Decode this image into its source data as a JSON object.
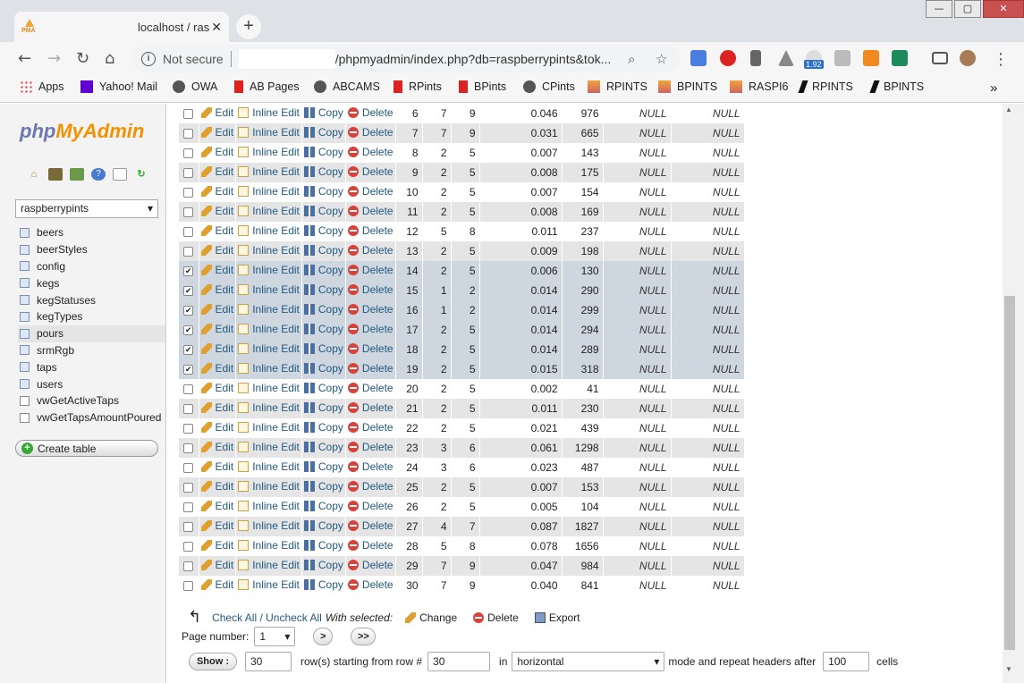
{
  "browser": {
    "tab_title": "localhost / ras",
    "tab_close": "✕",
    "newtab": "+",
    "window_min": "—",
    "window_max": "▢",
    "window_close": "✕",
    "security": "Not secure",
    "url": "/phpmyadmin/index.php?db=raspberrypints&tok...",
    "badge": "1.92",
    "favicon_text": "PMA"
  },
  "bookmarks": [
    {
      "label": "Apps",
      "icon": "apps-grid-icon"
    },
    {
      "label": "Yahoo! Mail",
      "icon": "envelope-icon"
    },
    {
      "label": "OWA",
      "icon": "globe-icon"
    },
    {
      "label": "AB Pages",
      "icon": "cup-icon"
    },
    {
      "label": "ABCAMS",
      "icon": "globe-icon"
    },
    {
      "label": "RPints",
      "icon": "cup-icon"
    },
    {
      "label": "BPints",
      "icon": "cup-icon"
    },
    {
      "label": "CPints",
      "icon": "globe-icon"
    },
    {
      "label": "RPINTS",
      "icon": "pma-icon"
    },
    {
      "label": "BPINTS",
      "icon": "pma-icon"
    },
    {
      "label": "RASPI6",
      "icon": "pma-icon"
    },
    {
      "label": "RPINTS",
      "icon": "feather-icon"
    },
    {
      "label": "BPINTS",
      "icon": "feather-icon"
    }
  ],
  "bookmarks_more": "»",
  "nav": {
    "logo_a": "php",
    "logo_b": "MyAdmin",
    "db_selected": "raspberrypints",
    "tables": [
      "beers",
      "beerStyles",
      "config",
      "kegs",
      "kegStatuses",
      "kegTypes",
      "pours",
      "srmRgb",
      "taps",
      "users",
      "vwGetActiveTaps",
      "vwGetTapsAmountPoured"
    ],
    "selected_table": "pours",
    "create_table": "Create table"
  },
  "actions": {
    "edit": "Edit",
    "inline_edit": "Inline Edit",
    "copy": "Copy",
    "delete": "Delete"
  },
  "rows": [
    {
      "id": "6",
      "a": "7",
      "b": "9",
      "c": "0.046",
      "d": "976",
      "e": "NULL",
      "f": "NULL",
      "checked": false
    },
    {
      "id": "7",
      "a": "7",
      "b": "9",
      "c": "0.031",
      "d": "665",
      "e": "NULL",
      "f": "NULL",
      "checked": false
    },
    {
      "id": "8",
      "a": "2",
      "b": "5",
      "c": "0.007",
      "d": "143",
      "e": "NULL",
      "f": "NULL",
      "checked": false
    },
    {
      "id": "9",
      "a": "2",
      "b": "5",
      "c": "0.008",
      "d": "175",
      "e": "NULL",
      "f": "NULL",
      "checked": false
    },
    {
      "id": "10",
      "a": "2",
      "b": "5",
      "c": "0.007",
      "d": "154",
      "e": "NULL",
      "f": "NULL",
      "checked": false
    },
    {
      "id": "11",
      "a": "2",
      "b": "5",
      "c": "0.008",
      "d": "169",
      "e": "NULL",
      "f": "NULL",
      "checked": false
    },
    {
      "id": "12",
      "a": "5",
      "b": "8",
      "c": "0.011",
      "d": "237",
      "e": "NULL",
      "f": "NULL",
      "checked": false
    },
    {
      "id": "13",
      "a": "2",
      "b": "5",
      "c": "0.009",
      "d": "198",
      "e": "NULL",
      "f": "NULL",
      "checked": false
    },
    {
      "id": "14",
      "a": "2",
      "b": "5",
      "c": "0.006",
      "d": "130",
      "e": "NULL",
      "f": "NULL",
      "checked": true
    },
    {
      "id": "15",
      "a": "1",
      "b": "2",
      "c": "0.014",
      "d": "290",
      "e": "NULL",
      "f": "NULL",
      "checked": true
    },
    {
      "id": "16",
      "a": "1",
      "b": "2",
      "c": "0.014",
      "d": "299",
      "e": "NULL",
      "f": "NULL",
      "checked": true
    },
    {
      "id": "17",
      "a": "2",
      "b": "5",
      "c": "0.014",
      "d": "294",
      "e": "NULL",
      "f": "NULL",
      "checked": true
    },
    {
      "id": "18",
      "a": "2",
      "b": "5",
      "c": "0.014",
      "d": "289",
      "e": "NULL",
      "f": "NULL",
      "checked": true
    },
    {
      "id": "19",
      "a": "2",
      "b": "5",
      "c": "0.015",
      "d": "318",
      "e": "NULL",
      "f": "NULL",
      "checked": true
    },
    {
      "id": "20",
      "a": "2",
      "b": "5",
      "c": "0.002",
      "d": "41",
      "e": "NULL",
      "f": "NULL",
      "checked": false
    },
    {
      "id": "21",
      "a": "2",
      "b": "5",
      "c": "0.011",
      "d": "230",
      "e": "NULL",
      "f": "NULL",
      "checked": false
    },
    {
      "id": "22",
      "a": "2",
      "b": "5",
      "c": "0.021",
      "d": "439",
      "e": "NULL",
      "f": "NULL",
      "checked": false
    },
    {
      "id": "23",
      "a": "3",
      "b": "6",
      "c": "0.061",
      "d": "1298",
      "e": "NULL",
      "f": "NULL",
      "checked": false
    },
    {
      "id": "24",
      "a": "3",
      "b": "6",
      "c": "0.023",
      "d": "487",
      "e": "NULL",
      "f": "NULL",
      "checked": false
    },
    {
      "id": "25",
      "a": "2",
      "b": "5",
      "c": "0.007",
      "d": "153",
      "e": "NULL",
      "f": "NULL",
      "checked": false
    },
    {
      "id": "26",
      "a": "2",
      "b": "5",
      "c": "0.005",
      "d": "104",
      "e": "NULL",
      "f": "NULL",
      "checked": false
    },
    {
      "id": "27",
      "a": "4",
      "b": "7",
      "c": "0.087",
      "d": "1827",
      "e": "NULL",
      "f": "NULL",
      "checked": false
    },
    {
      "id": "28",
      "a": "5",
      "b": "8",
      "c": "0.078",
      "d": "1656",
      "e": "NULL",
      "f": "NULL",
      "checked": false
    },
    {
      "id": "29",
      "a": "7",
      "b": "9",
      "c": "0.047",
      "d": "984",
      "e": "NULL",
      "f": "NULL",
      "checked": false
    },
    {
      "id": "30",
      "a": "7",
      "b": "9",
      "c": "0.040",
      "d": "841",
      "e": "NULL",
      "f": "NULL",
      "checked": false
    }
  ],
  "footer": {
    "check_all": "Check All / Uncheck All",
    "with_selected": "With selected:",
    "change": "Change",
    "delete": "Delete",
    "export": "Export",
    "page_number_label": "Page number:",
    "page_number": "1",
    "next": ">",
    "last": ">>",
    "show": "Show :",
    "rows_value": "30",
    "rows_label": "row(s) starting from row #",
    "start_row": "30",
    "in_label": "in",
    "mode": "horizontal",
    "mode_label": "mode and repeat headers after",
    "repeat": "100",
    "cells_label": "cells"
  }
}
